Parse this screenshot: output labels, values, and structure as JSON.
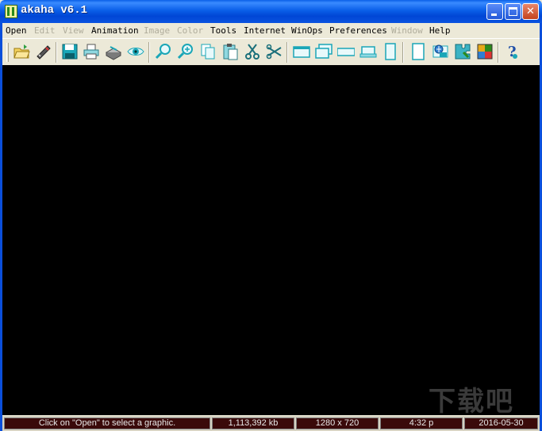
{
  "window": {
    "title": "akaha v6.1"
  },
  "menubar": {
    "items": [
      {
        "label": "Open",
        "enabled": true
      },
      {
        "label": "Edit",
        "enabled": false
      },
      {
        "label": "View",
        "enabled": false
      },
      {
        "label": "Animation",
        "enabled": true
      },
      {
        "label": "Image",
        "enabled": false
      },
      {
        "label": "Color",
        "enabled": false
      },
      {
        "label": "Tools",
        "enabled": true
      },
      {
        "label": "Internet",
        "enabled": true
      },
      {
        "label": "WinOps",
        "enabled": true
      },
      {
        "label": "Preferences",
        "enabled": true
      },
      {
        "label": "Window",
        "enabled": false
      },
      {
        "label": "Help",
        "enabled": true
      }
    ]
  },
  "toolbar": {
    "buttons": [
      "open-folder-icon",
      "scanner-icon",
      "save-icon",
      "print-icon",
      "scan-print-icon",
      "eye-view-icon",
      "zoom-in-icon",
      "zoom-out-icon",
      "copy-icon",
      "paste-icon",
      "cut-icon",
      "crop-icon",
      "window-cascade-icon",
      "window-tile-icon",
      "window-wide-icon",
      "window-min-icon",
      "window-tall-icon",
      "page-icon",
      "web-icon",
      "puzzle-blue-icon",
      "puzzle-color-icon",
      "help-icon"
    ]
  },
  "canvas": {
    "background": "#000000",
    "watermark": "下载吧"
  },
  "statusbar": {
    "message": "Click on \"Open\" to select a graphic.",
    "memory": "1,113,392 kb",
    "resolution": "1280 x 720",
    "time": "4:32 p",
    "date": "2016-05-30"
  },
  "colors": {
    "titlebar": "#0a5fe8",
    "status_cell_bg": "#3a0a0a",
    "disabled_menu": "#b0ad9c",
    "icon_accent": "#1aa6b7"
  }
}
